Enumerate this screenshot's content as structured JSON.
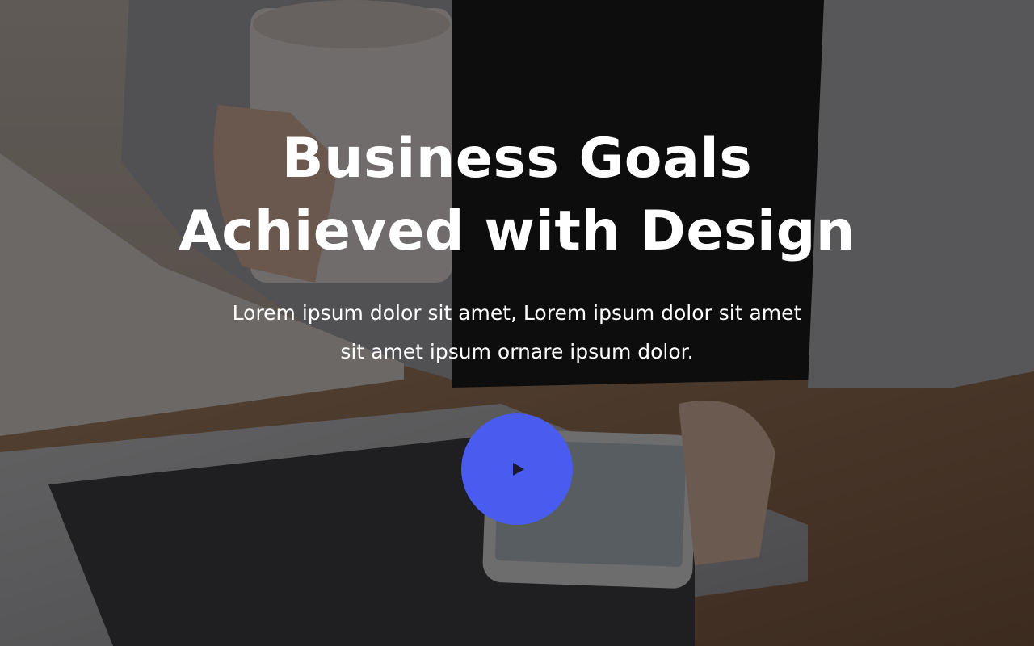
{
  "hero": {
    "title_line_1": "Business Goals",
    "title_line_2": "Achieved with Design",
    "subtitle_line_1": "Lorem ipsum dolor sit amet, Lorem ipsum dolor sit amet",
    "subtitle_line_2": "sit amet ipsum ornare ipsum dolor.",
    "play_icon": "play-icon",
    "colors": {
      "accent": "#4a5cf0",
      "text": "#ffffff",
      "overlay": "rgba(10,8,8,0.55)"
    }
  }
}
